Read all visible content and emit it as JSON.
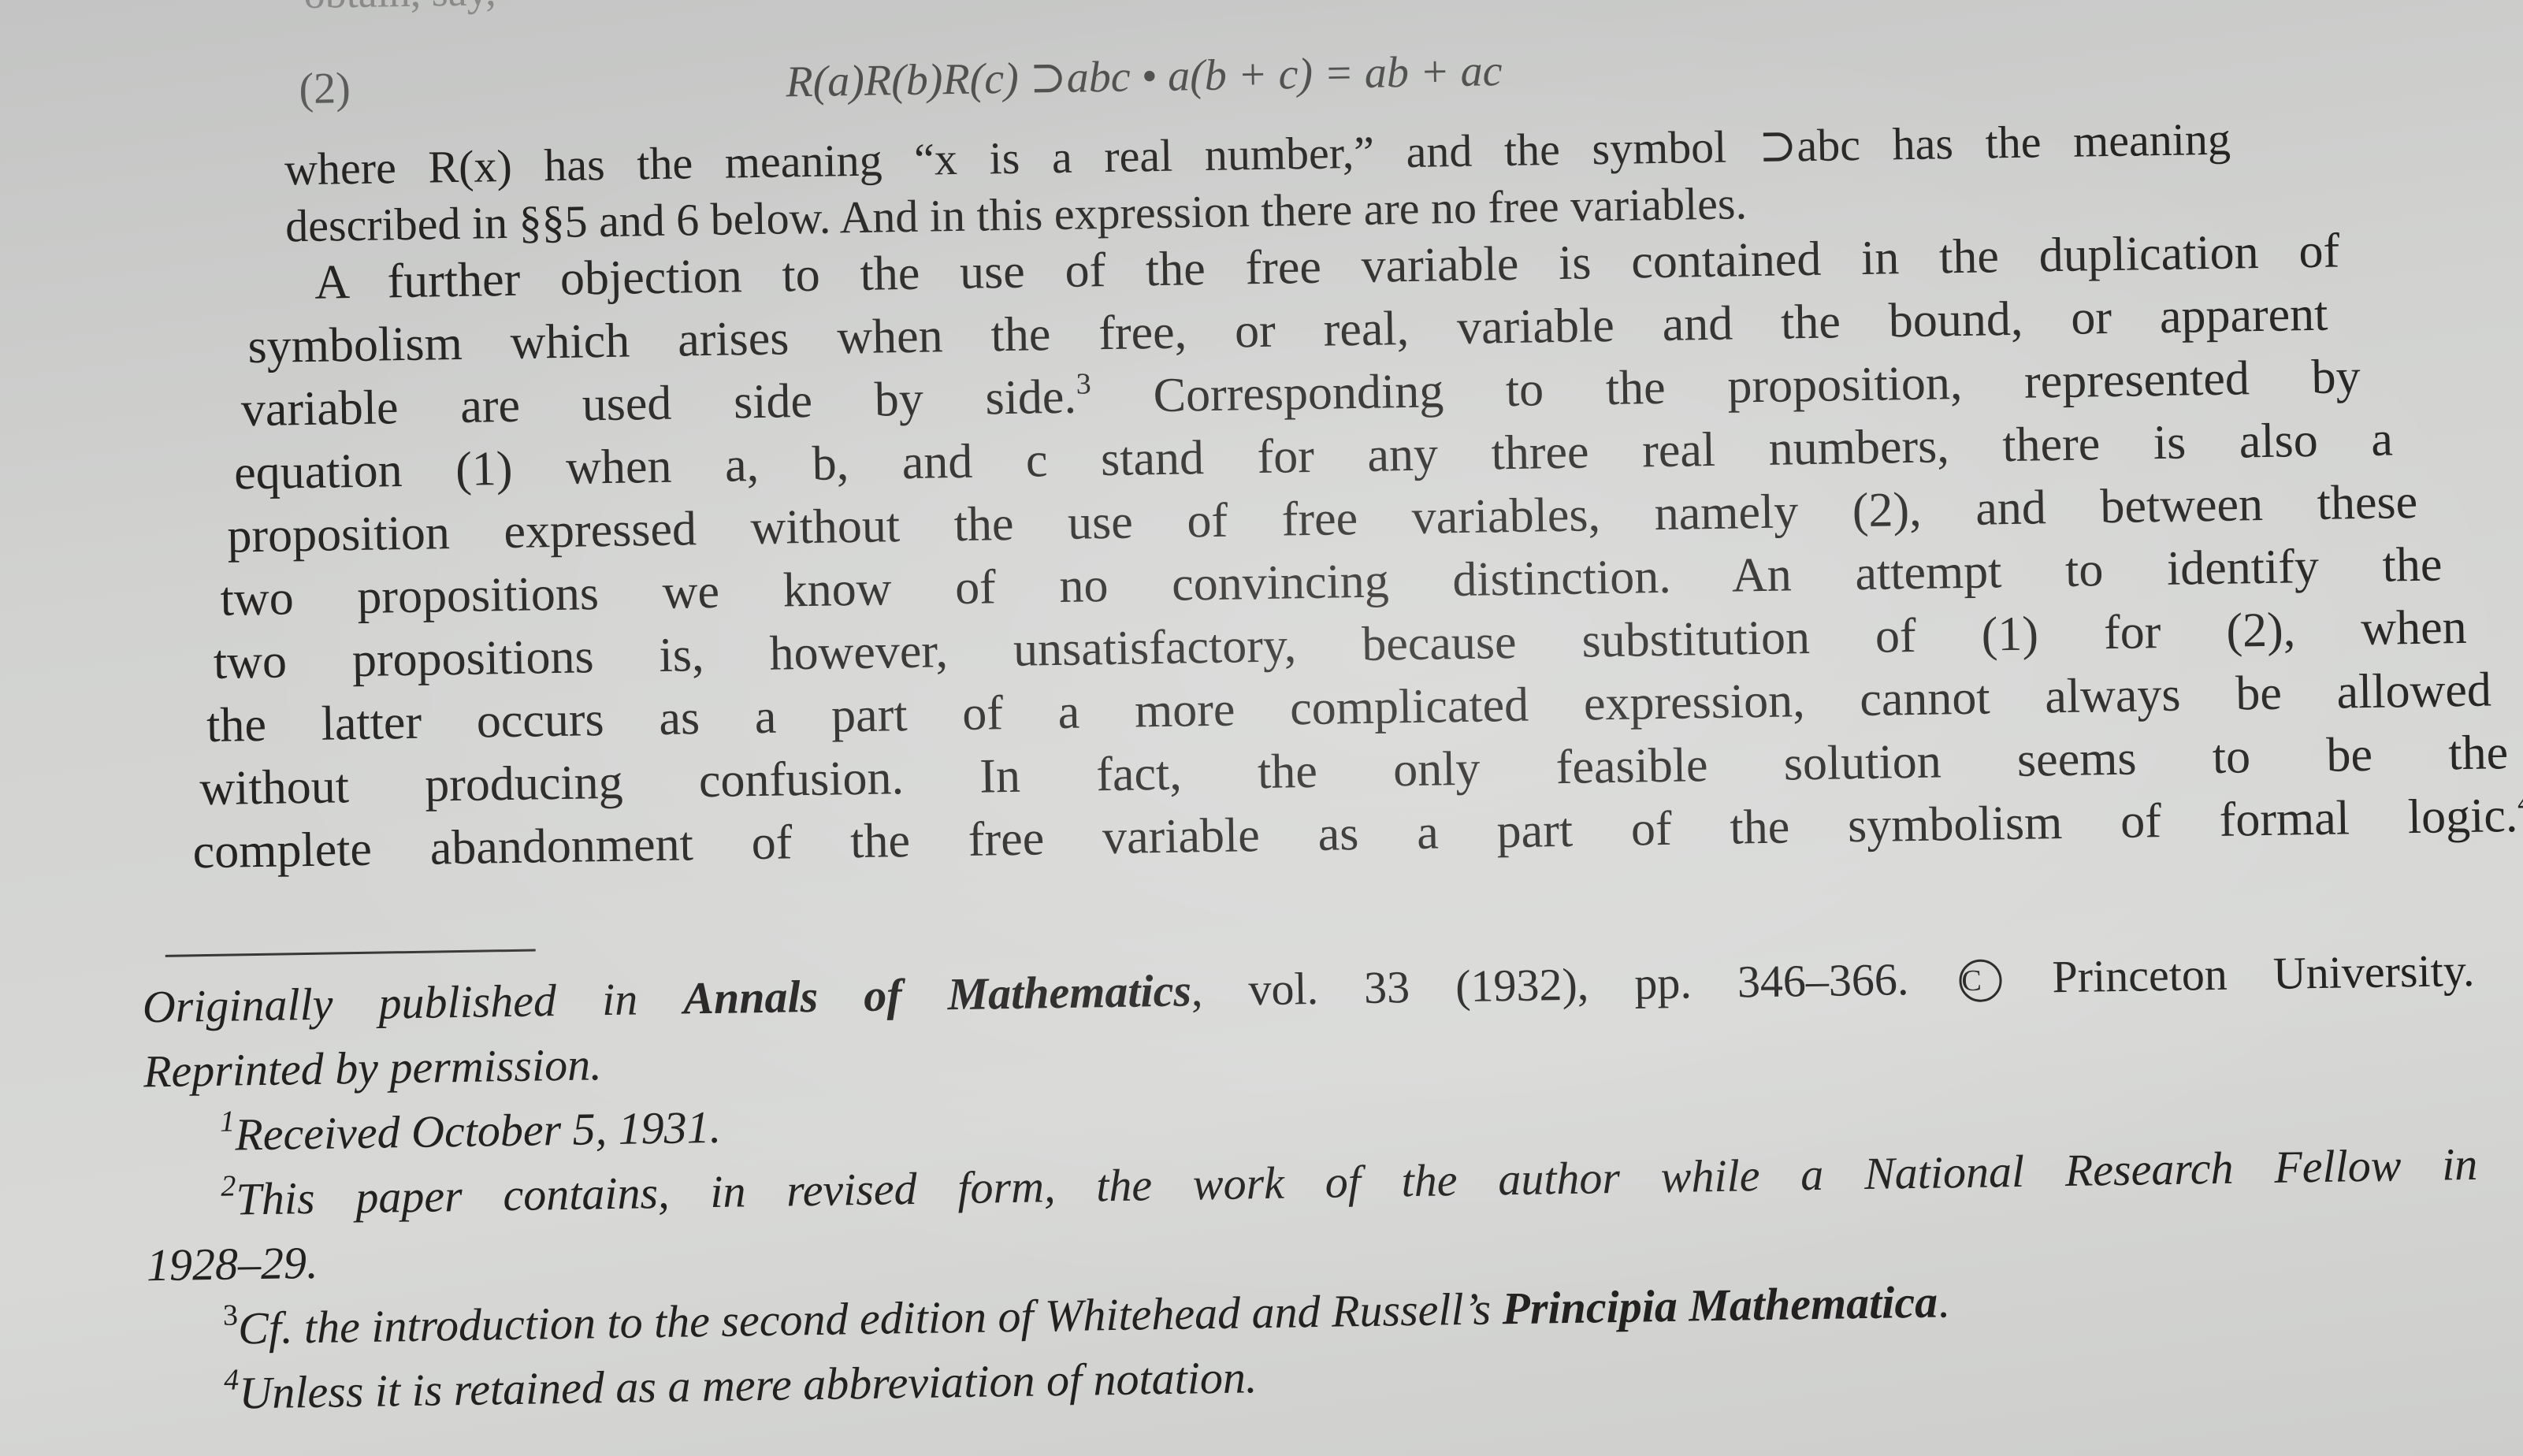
{
  "top_fragment": "obtain, say,",
  "equation": {
    "number": "(2)",
    "expression": "R(a)R(b)R(c) ⊃abc • a(b + c) = ab + ac"
  },
  "paragraph1": [
    "where R(x) has the meaning “x is a real number,” and the symbol ⊃abc has the meaning",
    "described in §§5 and 6 below. And in this expression there are no free variables."
  ],
  "paragraph2": [
    "A further objection to the use of the free variable is contained in the duplication of",
    "symbolism which arises when the free, or real, variable and the bound, or apparent",
    "variable are used side by side.",
    "Corresponding to the proposition, represented by",
    "equation (1) when a, b, and c stand for any three real numbers, there is also a",
    "proposition expressed without the use of free variables, namely (2), and between these",
    "two propositions we know of no convincing distinction. An attempt to identify the",
    "two propositions is, however, unsatisfactory, because substitution of (1) for (2), when",
    "the latter occurs as a part of a more complicated expression, cannot always be allowed",
    "without producing confusion. In fact, the only feasible solution seems to be the",
    "complete abandonment of the free variable as a part of the symbolism of formal logic."
  ],
  "footnote_marks": {
    "n1": "1",
    "n2": "2",
    "n3": "3",
    "n4": "4"
  },
  "footnotes": {
    "publication_prefix": "Originally published in",
    "journal": "Annals of Mathematics",
    "publication_suffix": ", vol. 33 (1932), pp. 346–366.",
    "copyright_symbol": "C",
    "copyright_holder": "Princeton University.",
    "reprint": "Reprinted by permission.",
    "fn1": "Received October 5, 1931.",
    "fn2_line1": "This paper contains, in revised form, the work of the author while a National Research Fellow in",
    "fn2_line2": "1928–29.",
    "fn3_prefix": "Cf. the introduction to the second edition of Whitehead and Russell’s",
    "fn3_title": "Principia Mathematica",
    "fn3_suffix": ".",
    "fn4": "Unless it is retained as a mere abbreviation of notation."
  }
}
